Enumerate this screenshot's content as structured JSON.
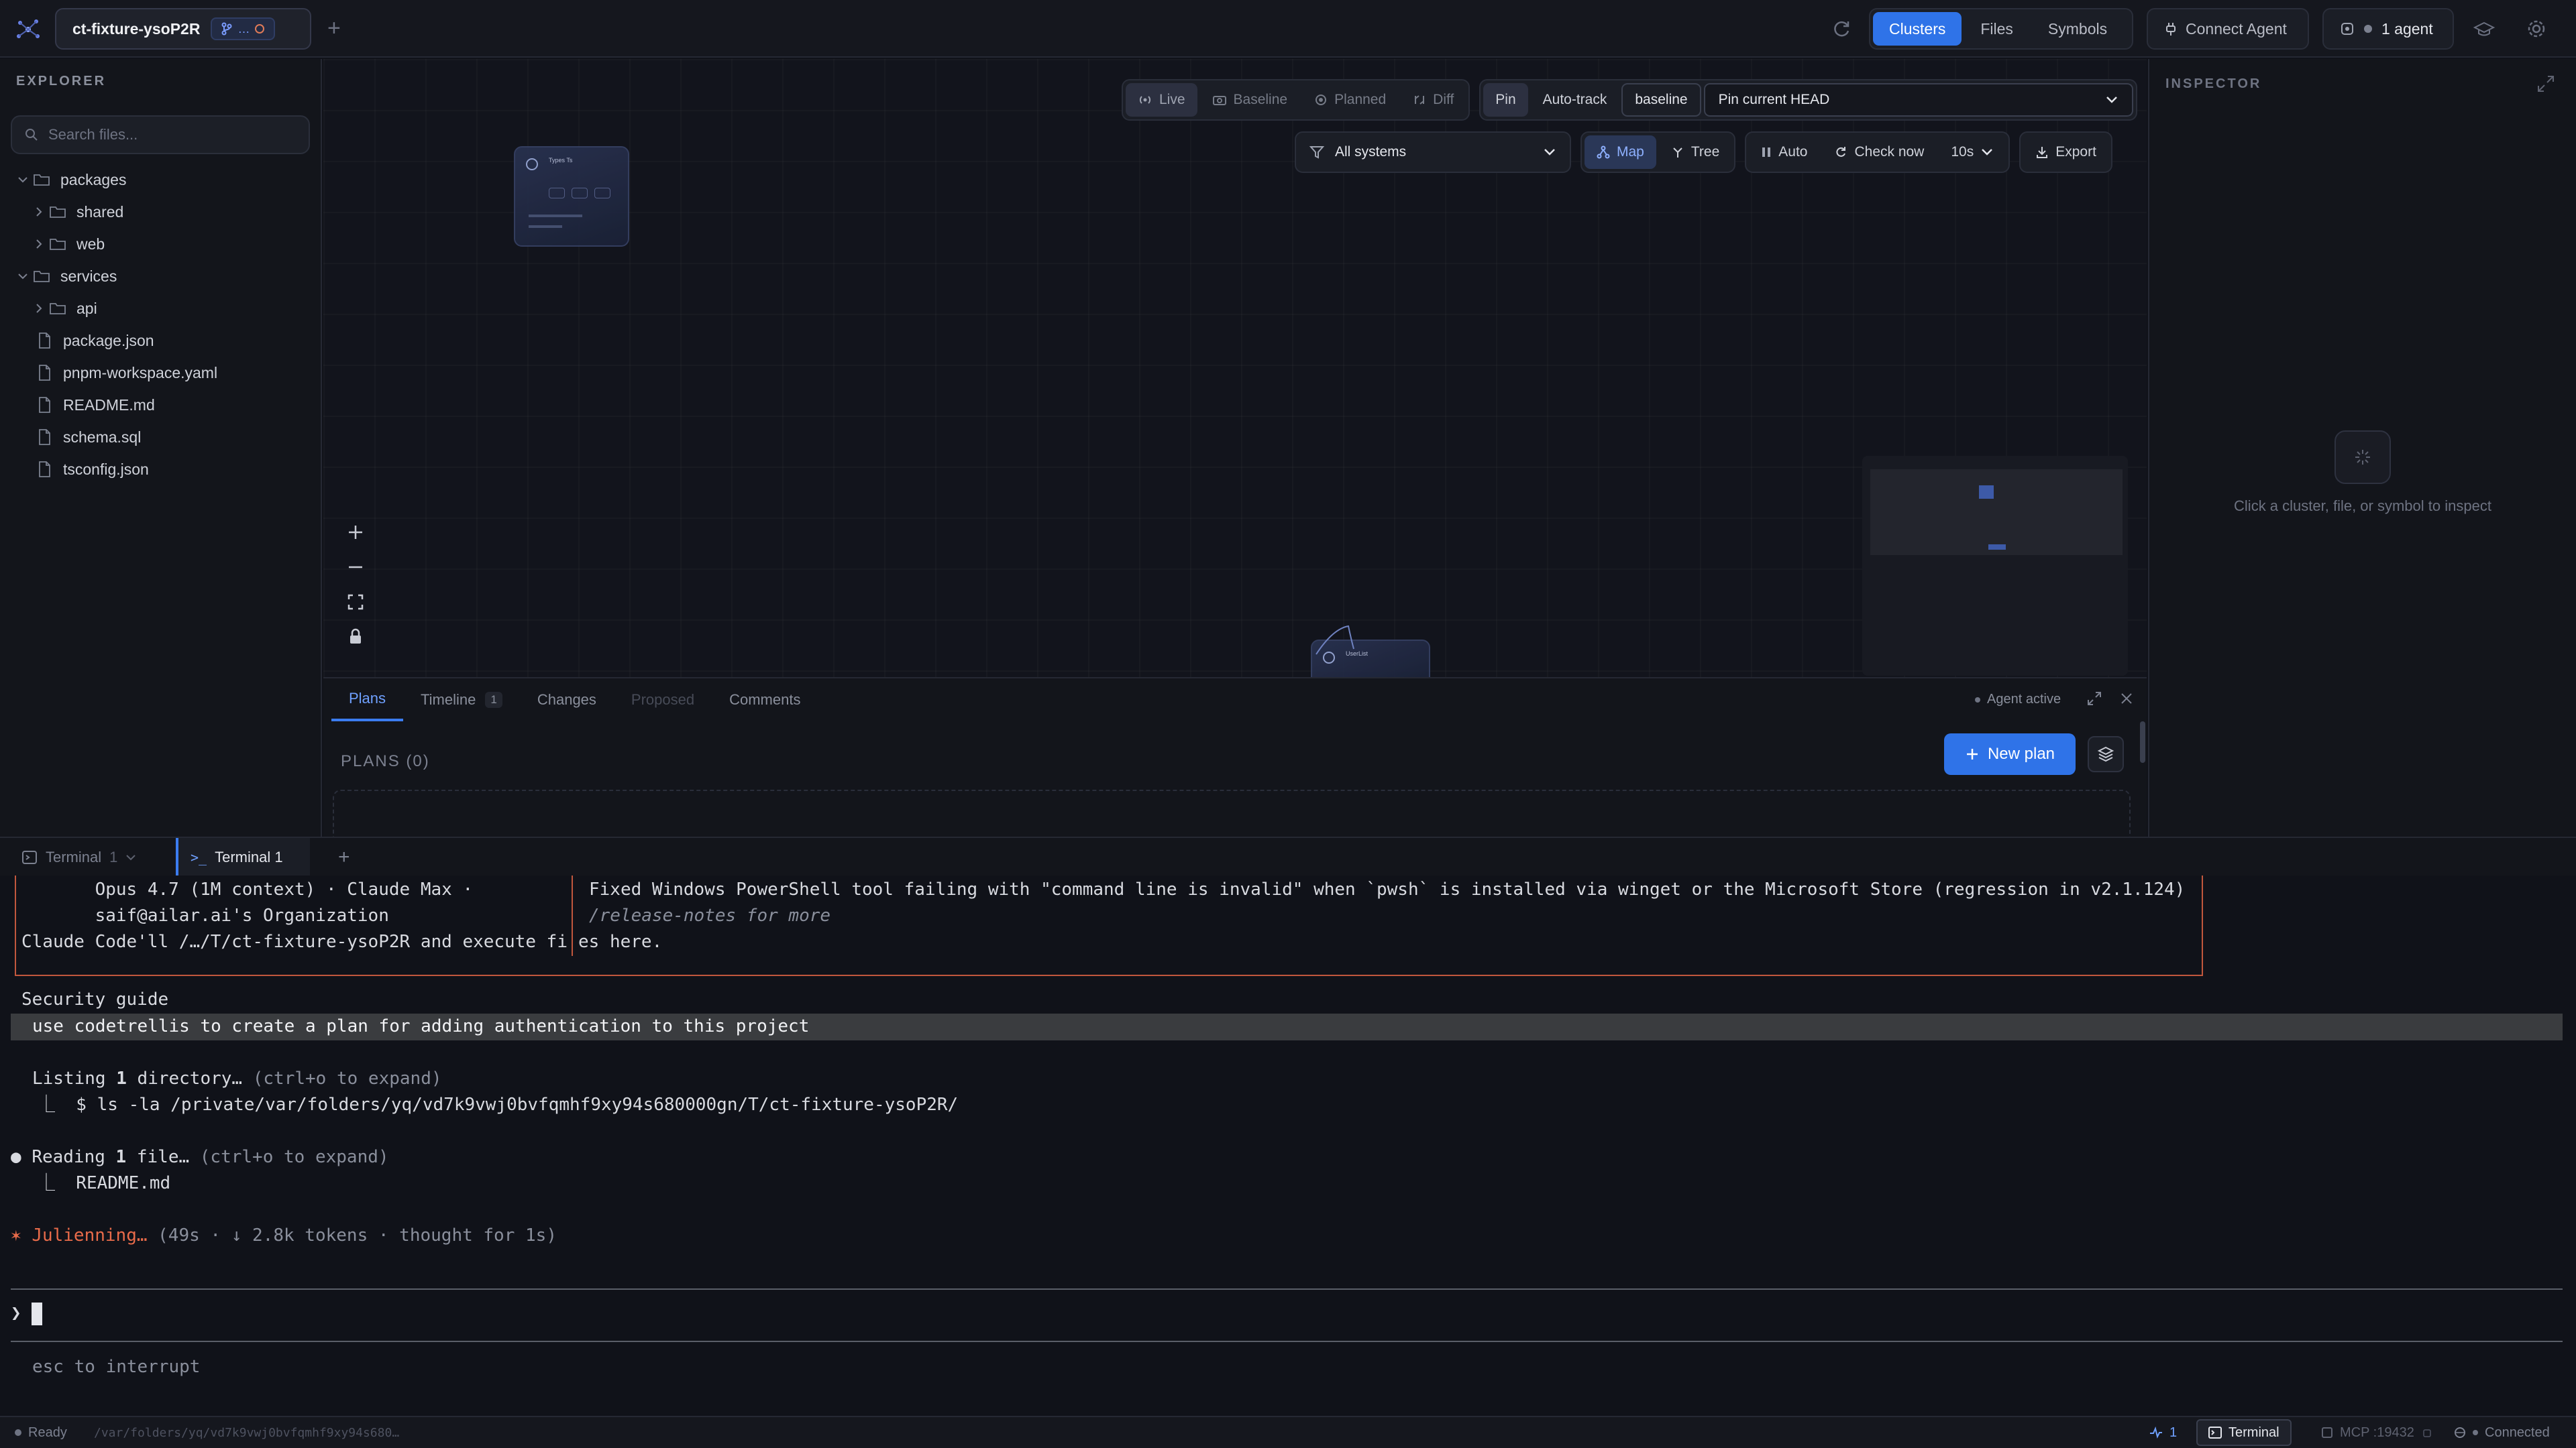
{
  "topbar": {
    "project_name": "ct-fixture-ysoP2R",
    "branch_label": "…",
    "add_tab": "+",
    "view_tabs": [
      "Clusters",
      "Files",
      "Symbols"
    ],
    "active_view": "Clusters",
    "connect_agent": "Connect Agent",
    "agent_count": "1 agent",
    "accent_color": "#2f73e8"
  },
  "explorer": {
    "title": "EXPLORER",
    "search_placeholder": "Search files...",
    "tree": [
      {
        "label": "packages",
        "type": "folder",
        "expanded": true,
        "depth": 0
      },
      {
        "label": "shared",
        "type": "folder",
        "expanded": false,
        "depth": 1
      },
      {
        "label": "web",
        "type": "folder",
        "expanded": false,
        "depth": 1
      },
      {
        "label": "services",
        "type": "folder",
        "expanded": true,
        "depth": 0
      },
      {
        "label": "api",
        "type": "folder",
        "expanded": false,
        "depth": 1
      },
      {
        "label": "package.json",
        "type": "file",
        "depth": 0
      },
      {
        "label": "pnpm-workspace.yaml",
        "type": "file",
        "depth": 0
      },
      {
        "label": "README.md",
        "type": "file",
        "depth": 0
      },
      {
        "label": "schema.sql",
        "type": "file",
        "depth": 0
      },
      {
        "label": "tsconfig.json",
        "type": "file",
        "depth": 0
      }
    ]
  },
  "canvas": {
    "mode_tabs": [
      "Live",
      "Baseline",
      "Planned",
      "Diff"
    ],
    "active_mode": "Live",
    "pin_label": "Pin",
    "autotrack_label": "Auto-track",
    "baseline_label": "baseline",
    "pin_select_value": "Pin current HEAD",
    "systems_select_value": "All systems",
    "map_label": "Map",
    "tree_label": "Tree",
    "auto_label": "Auto",
    "check_now_label": "Check now",
    "interval_value": "10s",
    "export_label": "Export",
    "nodes": [
      {
        "title": "Types Ts"
      },
      {
        "title": "UserList"
      }
    ]
  },
  "inspector": {
    "title": "INSPECTOR",
    "empty_hint": "Click a cluster, file, or symbol to inspect"
  },
  "plans_panel": {
    "tabs": [
      {
        "label": "Plans",
        "badge": "",
        "active": true
      },
      {
        "label": "Timeline",
        "badge": "1",
        "active": false
      },
      {
        "label": "Changes",
        "badge": "",
        "active": false
      },
      {
        "label": "Proposed",
        "badge": "",
        "active": false
      },
      {
        "label": "Comments",
        "badge": "",
        "active": false
      }
    ],
    "agent_status": "Agent active",
    "plans_heading": "PLANS (0)",
    "new_plan_label": "New plan"
  },
  "terminal": {
    "dropdown_label": "Terminal",
    "dropdown_count": "1",
    "active_tab": "Terminal 1",
    "add_tab": "+",
    "banner_left": [
      "       Opus 4.7 (1M context) · Claude Max · ",
      "       saif@ailar.ai's Organization",
      "Claude Code'll /…/T/ct-fixture-ysoP2R and execute fi"
    ],
    "banner_right": [
      "Fixed Windows PowerShell tool failing with \"command line is invalid\" when `pwsh` is installed via winget or the Microsoft Store (regression in v2.1.124)",
      "/release-notes for more",
      "es here."
    ],
    "security_guide": "Security guide",
    "user_prompt": "use codetrellis to create a plan for adding authentication to this project",
    "listing_prefix": "Listing ",
    "listing_count": "1",
    "listing_word": " directory… ",
    "listing_hint": "(ctrl+o to expand)",
    "listing_cmd": "⎿  $ ls -la /private/var/folders/yq/vd7k9vwj0bvfqmhf9xy94s680000gn/T/ct-fixture-ysoP2R/",
    "reading_prefix": "Reading ",
    "reading_count": "1",
    "reading_word": " file… ",
    "reading_hint": "(ctrl+o to expand)",
    "reading_file": "⎿  README.md",
    "status_word": "Julienning…",
    "status_detail": " (49s · ↓ 2.8k tokens · thought for 1s)",
    "prompt_symbol": "❯",
    "interrupt_hint": "esc to interrupt"
  },
  "statusbar": {
    "ready": "Ready",
    "path": "/var/folders/yq/vd7k9vwj0bvfqmhf9xy94s680…",
    "activity_count": "1",
    "terminal_label": "Terminal",
    "mcp_label": "MCP :19432",
    "connection": "Connected"
  }
}
